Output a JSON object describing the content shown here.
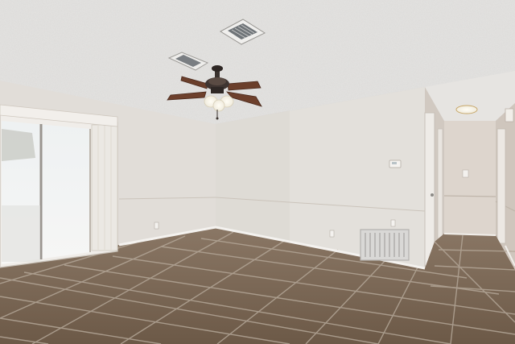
{
  "scene": {
    "kind": "photo",
    "subject": "empty-room-interior"
  },
  "colors": {
    "ceiling": "#e6e5e3",
    "wall_light": "#e2dfda",
    "wall_shadow": "#d2ccc5",
    "hall_wall": "#d9d1c9",
    "floor_base": "#7d6a57",
    "floor_grout": "#b1a496",
    "window_glass": "#f3f3f2",
    "door_frame": "#f1efec",
    "fan_blade": "#6a3f2c",
    "fan_body": "#3b332f",
    "light_glow": "#f7f4ea",
    "vent": "#c9c9c9"
  }
}
